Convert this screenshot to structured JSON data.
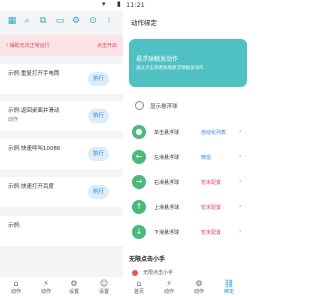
{
  "status": {
    "time": "11:21"
  },
  "left": {
    "warning": {
      "message": "! 辅助无法正常运行",
      "action": "点击开启"
    },
    "cards": [
      {
        "title": "示例:重复打开手电筒",
        "sub": "",
        "button": "执行"
      },
      {
        "title": "示例:返回桌面并滑动",
        "sub": "动作",
        "button": "执行"
      },
      {
        "title": "示例:快速呼叫10086",
        "sub": "",
        "button": "执行"
      },
      {
        "title": "示例:快速打开百度",
        "sub": "",
        "button": "执行"
      },
      {
        "title": "示例:",
        "sub": "",
        "button": ""
      }
    ],
    "nav": [
      "动作",
      "动作",
      "设置",
      "设置"
    ]
  },
  "right": {
    "header": "动作绑定",
    "banner": {
      "title": "悬浮球触发动作",
      "sub": "通过点击或者拖拽悬浮球触发动作"
    },
    "show_label": "显示悬浮球",
    "rows": [
      {
        "name": "单击悬浮球",
        "value": "自动化列表",
        "color": "#2f86d6"
      },
      {
        "name": "左滑悬浮球",
        "value": "微信",
        "color": "#2f86d6"
      },
      {
        "name": "右滑悬浮球",
        "value": "暂未配置",
        "color": "#e24a5f"
      },
      {
        "name": "上滑悬浮球",
        "value": "暂未配置",
        "color": "#e24a5f"
      },
      {
        "name": "下滑悬浮球",
        "value": "暂未配置",
        "color": "#e24a5f"
      }
    ],
    "section": "无限点击小手",
    "section_row": "无限点击小手",
    "nav": [
      "首页",
      "动作",
      "动作",
      "绑定"
    ]
  },
  "colors": {
    "accent": "#33a6b8",
    "banner": "#4fc1c4",
    "green": "#49b97a",
    "warning_bg": "#fbe3e7"
  }
}
